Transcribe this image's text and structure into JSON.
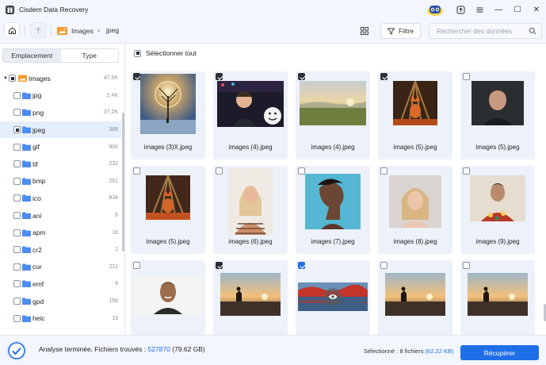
{
  "app": {
    "title": "Cisdem Data Recovery"
  },
  "window_controls": {
    "minimize": "—",
    "maximize": "☐",
    "close": "✕"
  },
  "toolbar": {
    "breadcrumb": [
      "Images",
      "jpeg"
    ],
    "filter_label": "Filtre",
    "search_placeholder": "Rechercher des données"
  },
  "sidebar": {
    "tabs": [
      "Emplacement",
      "Type"
    ],
    "active_tab": "Type",
    "root": {
      "label": "Images",
      "count": "47.5K"
    },
    "items": [
      {
        "label": "jpg",
        "count": "2.4K"
      },
      {
        "label": "png",
        "count": "37.2K"
      },
      {
        "label": "jpeg",
        "count": "388"
      },
      {
        "label": "gif",
        "count": "900"
      },
      {
        "label": "tif",
        "count": "232"
      },
      {
        "label": "bmp",
        "count": "261"
      },
      {
        "label": "ico",
        "count": "834"
      },
      {
        "label": "ani",
        "count": "6"
      },
      {
        "label": "apm",
        "count": "16"
      },
      {
        "label": "cr2",
        "count": "1"
      },
      {
        "label": "cur",
        "count": "211"
      },
      {
        "label": "emf",
        "count": "6"
      },
      {
        "label": "gpd",
        "count": "156"
      },
      {
        "label": "heic",
        "count": "19"
      }
    ]
  },
  "main": {
    "select_all": "Sélectionner tout",
    "files": [
      {
        "name": "images (3)X.jpeg",
        "checked": true
      },
      {
        "name": "images (4).jpeg",
        "checked": true
      },
      {
        "name": "images (4).jpeg",
        "checked": true
      },
      {
        "name": "images (5).jpeg",
        "checked": true
      },
      {
        "name": "images (5).jpeg",
        "checked": false
      },
      {
        "name": "images (5).jpeg",
        "checked": false
      },
      {
        "name": "images (6).jpeg",
        "checked": false
      },
      {
        "name": "images (7).jpeg",
        "checked": false
      },
      {
        "name": "images (8).jpeg",
        "checked": false
      },
      {
        "name": "images (9).jpeg",
        "checked": false
      },
      {
        "name": "",
        "checked": false
      },
      {
        "name": "",
        "checked": true
      },
      {
        "name": "",
        "checked": true
      },
      {
        "name": "",
        "checked": false
      },
      {
        "name": "",
        "checked": false
      }
    ]
  },
  "status": {
    "prefix": "Analyse terminée, Fichiers trouvés : ",
    "count": "527870",
    "size": " (79.62 GB)",
    "selected_prefix": "Sélectionné : 8 fichiers ",
    "selected_size": "(62.22 KB)",
    "recover_label": "Récupérer"
  },
  "colors": {
    "accent": "#1e6ee8",
    "card_bg": "#edf1f9",
    "chrome_bg": "#f3f6fc"
  }
}
